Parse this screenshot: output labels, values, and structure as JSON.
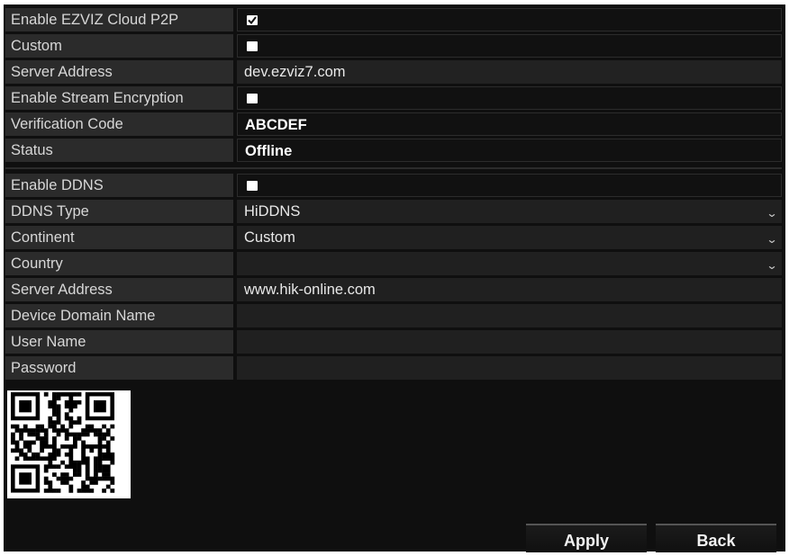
{
  "ezviz": {
    "rows": [
      {
        "label": "Enable EZVIZ Cloud P2P",
        "checked": true
      },
      {
        "label": "Custom",
        "checked": false
      },
      {
        "label": "Server Address",
        "value": "dev.ezviz7.com"
      },
      {
        "label": "Enable Stream Encryption",
        "checked": false
      },
      {
        "label": "Verification Code",
        "value": "ABCDEF"
      },
      {
        "label": "Status",
        "value": "Offline"
      }
    ]
  },
  "ddns": {
    "rows": [
      {
        "label": "Enable DDNS",
        "checked": false
      },
      {
        "label": "DDNS Type",
        "value": "HiDDNS",
        "dropdown": true
      },
      {
        "label": "Continent",
        "value": "Custom",
        "dropdown": true
      },
      {
        "label": "Country",
        "value": "",
        "dropdown": true
      },
      {
        "label": "Server Address",
        "value": "www.hik-online.com"
      },
      {
        "label": "Device Domain Name",
        "value": ""
      },
      {
        "label": "User Name",
        "value": ""
      },
      {
        "label": "Password",
        "value": ""
      }
    ]
  },
  "buttons": {
    "apply": "Apply",
    "back": "Back"
  },
  "icons": {
    "checkbox": "checkbox-icon",
    "dropdown": "chevron-down-icon",
    "qr": "qr-code-icon"
  },
  "colors": {
    "panel_bg": "#0f0f0f",
    "label_bg": "#2b2b2b",
    "text": "#d7d7d7"
  }
}
